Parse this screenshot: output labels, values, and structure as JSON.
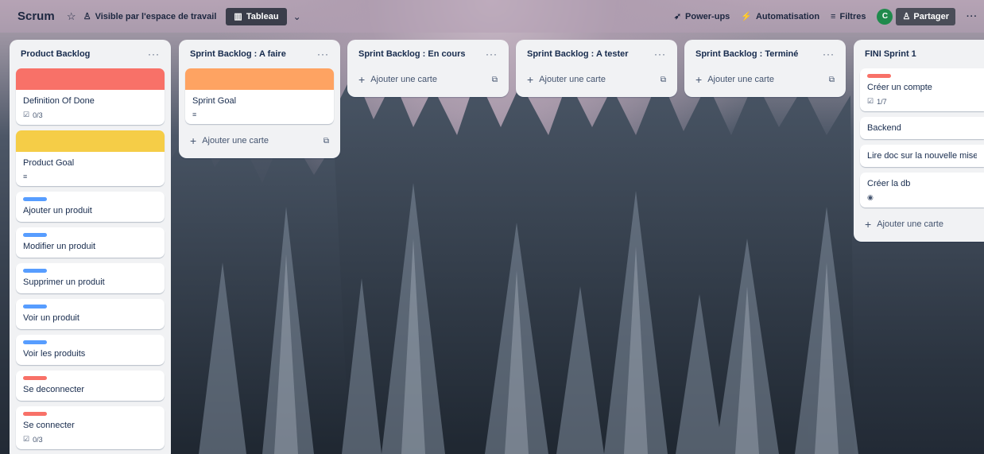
{
  "header": {
    "board_title": "Scrum",
    "visibility_label": "Visible par l'espace de travail",
    "view_label": "Tableau",
    "powerups_label": "Power-ups",
    "automation_label": "Automatisation",
    "filters_label": "Filtres",
    "avatar_initial": "C",
    "share_label": "Partager"
  },
  "colors": {
    "red": "#f87168",
    "orange": "#fea362",
    "yellow": "#f5cd47",
    "blue": "#579dff",
    "red_label": "#f87168"
  },
  "lists": [
    {
      "title": "Product Backlog",
      "cards": [
        {
          "title": "Definition Of Done",
          "checklist": "0/3"
        },
        {
          "title": "Product Goal"
        },
        {
          "title": "Ajouter un produit"
        },
        {
          "title": "Modifier un produit"
        },
        {
          "title": "Supprimer un produit"
        },
        {
          "title": "Voir un produit"
        },
        {
          "title": "Voir les produits"
        },
        {
          "title": "Se deconnecter"
        },
        {
          "title": "Se connecter",
          "checklist": "0/3"
        }
      ]
    },
    {
      "title": "Sprint Backlog : A faire",
      "cards": [
        {
          "title": "Sprint Goal"
        }
      ],
      "add_label": "Ajouter une carte"
    },
    {
      "title": "Sprint Backlog : En cours",
      "add_label": "Ajouter une carte"
    },
    {
      "title": "Sprint Backlog : A tester",
      "add_label": "Ajouter une carte"
    },
    {
      "title": "Sprint Backlog : Terminé",
      "add_label": "Ajouter une carte"
    },
    {
      "title": "FINI Sprint 1",
      "cards": [
        {
          "title": "Créer un compte",
          "checklist": "1/7"
        },
        {
          "title": "Backend"
        },
        {
          "title": "Lire doc sur la nouvelle mises"
        },
        {
          "title": "Créer la db"
        }
      ],
      "add_label": "Ajouter une carte"
    }
  ]
}
